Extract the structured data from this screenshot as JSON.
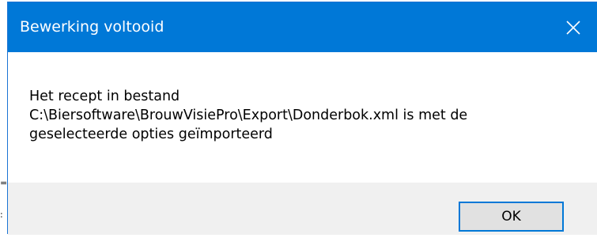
{
  "dialog": {
    "title": "Bewerking voltooid",
    "message_lines": [
      "Het recept in bestand",
      "C:\\Biersoftware\\BrouwVisiePro\\Export\\Donderbok.xml is met de",
      "geselecteerde opties geïmporteerd"
    ],
    "ok_label": "OK",
    "close_icon": "close-icon"
  },
  "colors": {
    "titlebar": "#0078d7",
    "title_text": "#ffffff",
    "footer": "#f0f0f0",
    "button_border": "#0078d7",
    "button_fill": "#e1e1e1"
  }
}
